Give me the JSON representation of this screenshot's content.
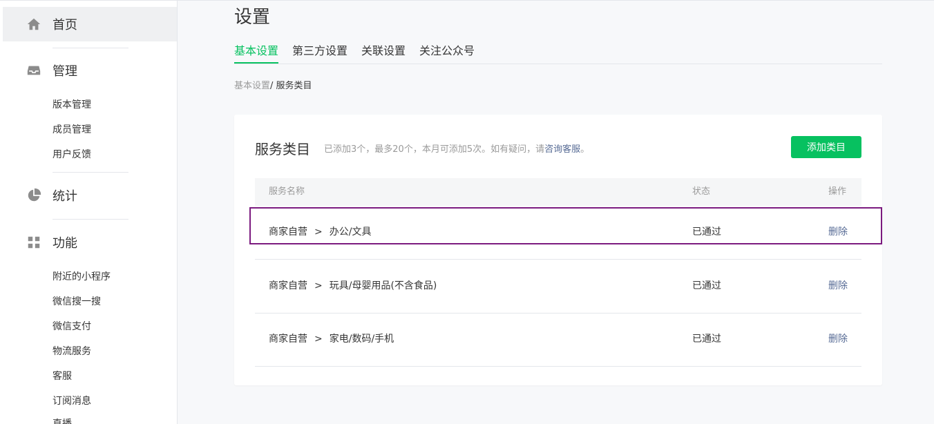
{
  "sidebar": {
    "home": {
      "label": "首页",
      "icon": "home-icon"
    },
    "manage": {
      "label": "管理",
      "icon": "inbox-icon",
      "items": [
        {
          "label": "版本管理"
        },
        {
          "label": "成员管理"
        },
        {
          "label": "用户反馈"
        }
      ]
    },
    "stats": {
      "label": "统计",
      "icon": "pie-chart-icon"
    },
    "features": {
      "label": "功能",
      "icon": "grid-icon",
      "items": [
        {
          "label": "附近的小程序"
        },
        {
          "label": "微信搜一搜"
        },
        {
          "label": "微信支付"
        },
        {
          "label": "物流服务"
        },
        {
          "label": "客服"
        },
        {
          "label": "订阅消息"
        },
        {
          "label": "直播"
        }
      ]
    }
  },
  "page": {
    "title": "设置",
    "tabs": [
      {
        "label": "基本设置",
        "active": true
      },
      {
        "label": "第三方设置"
      },
      {
        "label": "关联设置"
      },
      {
        "label": "关注公众号"
      }
    ],
    "breadcrumb": {
      "parent": "基本设置",
      "separator": "/ ",
      "current": "服务类目"
    }
  },
  "panel": {
    "title": "服务类目",
    "description": "已添加3个，最多20个，本月可添加5次。如有疑问，请",
    "help_link": "咨询客服",
    "help_suffix": "。",
    "add_button": "添加类目",
    "columns": {
      "name": "服务名称",
      "status": "状态",
      "action": "操作"
    },
    "rows": [
      {
        "primary": "商家自营",
        "arrow": ">",
        "secondary": "办公/文具",
        "status": "已通过",
        "action": "删除"
      },
      {
        "primary": "商家自营",
        "arrow": ">",
        "secondary": "玩具/母婴用品(不含食品)",
        "status": "已通过",
        "action": "删除"
      },
      {
        "primary": "商家自营",
        "arrow": ">",
        "secondary": "家电/数码/手机",
        "status": "已通过",
        "action": "删除"
      }
    ]
  },
  "colors": {
    "accent": "#07c160",
    "link": "#576b95",
    "highlight": "#7b1a7f"
  }
}
